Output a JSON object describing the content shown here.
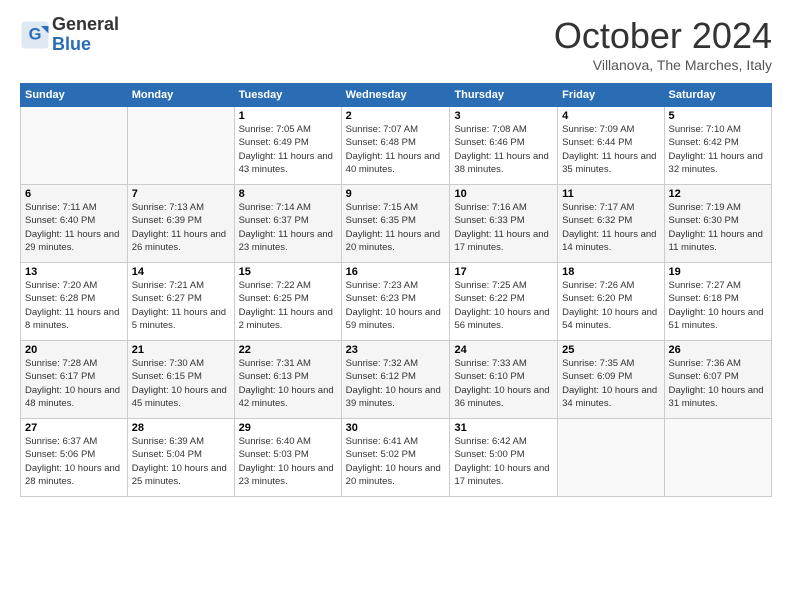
{
  "logo": {
    "general": "General",
    "blue": "Blue"
  },
  "header": {
    "month": "October 2024",
    "location": "Villanova, The Marches, Italy"
  },
  "weekdays": [
    "Sunday",
    "Monday",
    "Tuesday",
    "Wednesday",
    "Thursday",
    "Friday",
    "Saturday"
  ],
  "weeks": [
    [
      {
        "day": "",
        "info": ""
      },
      {
        "day": "",
        "info": ""
      },
      {
        "day": "1",
        "info": "Sunrise: 7:05 AM\nSunset: 6:49 PM\nDaylight: 11 hours and 43 minutes."
      },
      {
        "day": "2",
        "info": "Sunrise: 7:07 AM\nSunset: 6:48 PM\nDaylight: 11 hours and 40 minutes."
      },
      {
        "day": "3",
        "info": "Sunrise: 7:08 AM\nSunset: 6:46 PM\nDaylight: 11 hours and 38 minutes."
      },
      {
        "day": "4",
        "info": "Sunrise: 7:09 AM\nSunset: 6:44 PM\nDaylight: 11 hours and 35 minutes."
      },
      {
        "day": "5",
        "info": "Sunrise: 7:10 AM\nSunset: 6:42 PM\nDaylight: 11 hours and 32 minutes."
      }
    ],
    [
      {
        "day": "6",
        "info": "Sunrise: 7:11 AM\nSunset: 6:40 PM\nDaylight: 11 hours and 29 minutes."
      },
      {
        "day": "7",
        "info": "Sunrise: 7:13 AM\nSunset: 6:39 PM\nDaylight: 11 hours and 26 minutes."
      },
      {
        "day": "8",
        "info": "Sunrise: 7:14 AM\nSunset: 6:37 PM\nDaylight: 11 hours and 23 minutes."
      },
      {
        "day": "9",
        "info": "Sunrise: 7:15 AM\nSunset: 6:35 PM\nDaylight: 11 hours and 20 minutes."
      },
      {
        "day": "10",
        "info": "Sunrise: 7:16 AM\nSunset: 6:33 PM\nDaylight: 11 hours and 17 minutes."
      },
      {
        "day": "11",
        "info": "Sunrise: 7:17 AM\nSunset: 6:32 PM\nDaylight: 11 hours and 14 minutes."
      },
      {
        "day": "12",
        "info": "Sunrise: 7:19 AM\nSunset: 6:30 PM\nDaylight: 11 hours and 11 minutes."
      }
    ],
    [
      {
        "day": "13",
        "info": "Sunrise: 7:20 AM\nSunset: 6:28 PM\nDaylight: 11 hours and 8 minutes."
      },
      {
        "day": "14",
        "info": "Sunrise: 7:21 AM\nSunset: 6:27 PM\nDaylight: 11 hours and 5 minutes."
      },
      {
        "day": "15",
        "info": "Sunrise: 7:22 AM\nSunset: 6:25 PM\nDaylight: 11 hours and 2 minutes."
      },
      {
        "day": "16",
        "info": "Sunrise: 7:23 AM\nSunset: 6:23 PM\nDaylight: 10 hours and 59 minutes."
      },
      {
        "day": "17",
        "info": "Sunrise: 7:25 AM\nSunset: 6:22 PM\nDaylight: 10 hours and 56 minutes."
      },
      {
        "day": "18",
        "info": "Sunrise: 7:26 AM\nSunset: 6:20 PM\nDaylight: 10 hours and 54 minutes."
      },
      {
        "day": "19",
        "info": "Sunrise: 7:27 AM\nSunset: 6:18 PM\nDaylight: 10 hours and 51 minutes."
      }
    ],
    [
      {
        "day": "20",
        "info": "Sunrise: 7:28 AM\nSunset: 6:17 PM\nDaylight: 10 hours and 48 minutes."
      },
      {
        "day": "21",
        "info": "Sunrise: 7:30 AM\nSunset: 6:15 PM\nDaylight: 10 hours and 45 minutes."
      },
      {
        "day": "22",
        "info": "Sunrise: 7:31 AM\nSunset: 6:13 PM\nDaylight: 10 hours and 42 minutes."
      },
      {
        "day": "23",
        "info": "Sunrise: 7:32 AM\nSunset: 6:12 PM\nDaylight: 10 hours and 39 minutes."
      },
      {
        "day": "24",
        "info": "Sunrise: 7:33 AM\nSunset: 6:10 PM\nDaylight: 10 hours and 36 minutes."
      },
      {
        "day": "25",
        "info": "Sunrise: 7:35 AM\nSunset: 6:09 PM\nDaylight: 10 hours and 34 minutes."
      },
      {
        "day": "26",
        "info": "Sunrise: 7:36 AM\nSunset: 6:07 PM\nDaylight: 10 hours and 31 minutes."
      }
    ],
    [
      {
        "day": "27",
        "info": "Sunrise: 6:37 AM\nSunset: 5:06 PM\nDaylight: 10 hours and 28 minutes."
      },
      {
        "day": "28",
        "info": "Sunrise: 6:39 AM\nSunset: 5:04 PM\nDaylight: 10 hours and 25 minutes."
      },
      {
        "day": "29",
        "info": "Sunrise: 6:40 AM\nSunset: 5:03 PM\nDaylight: 10 hours and 23 minutes."
      },
      {
        "day": "30",
        "info": "Sunrise: 6:41 AM\nSunset: 5:02 PM\nDaylight: 10 hours and 20 minutes."
      },
      {
        "day": "31",
        "info": "Sunrise: 6:42 AM\nSunset: 5:00 PM\nDaylight: 10 hours and 17 minutes."
      },
      {
        "day": "",
        "info": ""
      },
      {
        "day": "",
        "info": ""
      }
    ]
  ]
}
